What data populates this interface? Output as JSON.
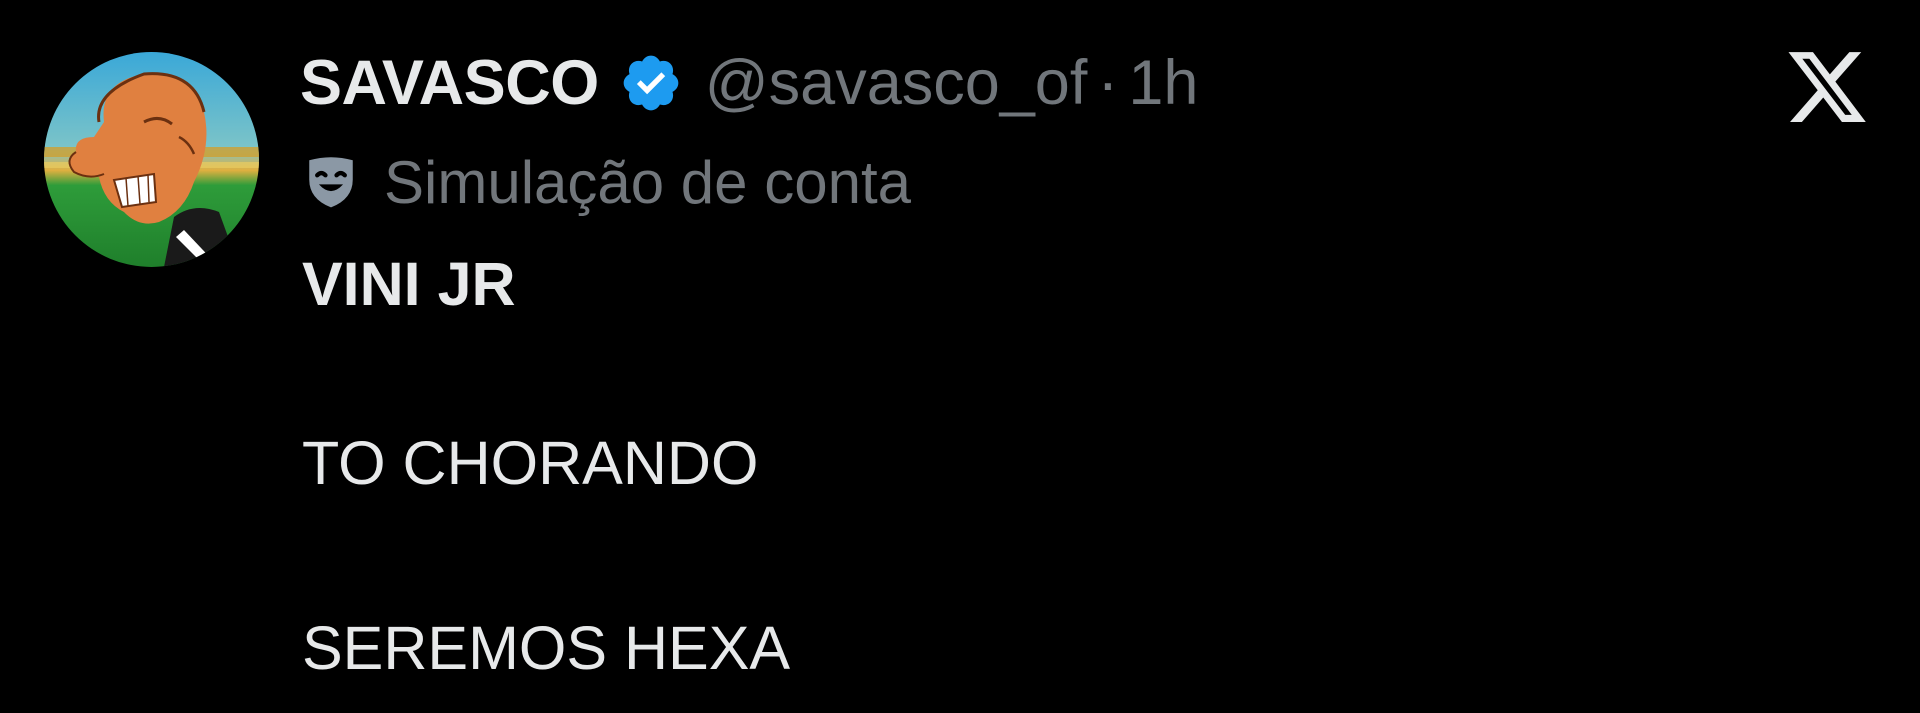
{
  "tweet": {
    "display_name": "SAVASCO",
    "handle": "@savasco_of",
    "separator": "·",
    "time": "1h",
    "account_label": "Simulação de conta",
    "lines": [
      "VINI JR",
      "TO CHORANDO",
      "SEREMOS HEXA"
    ]
  },
  "icons": {
    "avatar": "cartoon-avatar",
    "verified": "verified-badge-icon",
    "parody": "theater-mask-icon",
    "logo": "x-logo-icon"
  },
  "colors": {
    "background": "#000000",
    "primary_text": "#e7e9ea",
    "secondary_text": "#71767b",
    "verified_blue": "#1d9bf0"
  }
}
